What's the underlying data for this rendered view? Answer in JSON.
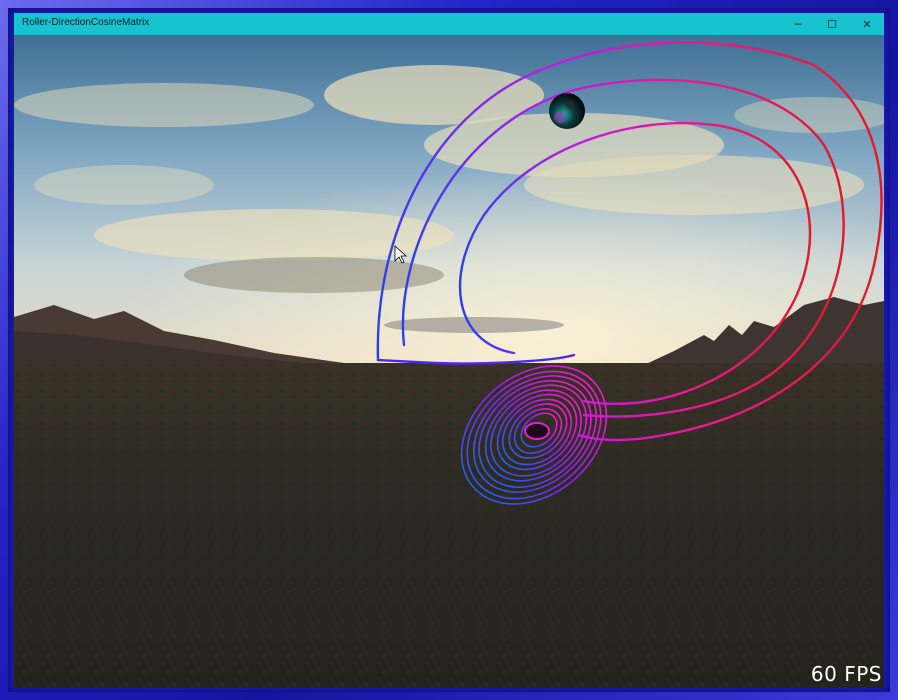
{
  "window": {
    "title": "Roller-DirectionCosineMatrix",
    "minimize_glyph": "─",
    "maximize_glyph": "☐",
    "close_glyph": "✕"
  },
  "scene": {
    "fps_label": "60 FPS",
    "objects": [
      "sky",
      "clouds",
      "mountains",
      "desert-ground",
      "attractor-curve",
      "sphere"
    ]
  },
  "colors": {
    "titlebar": "#17c3cf",
    "curve_red": "#e01a24",
    "curve_magenta": "#e21ad6",
    "curve_purple": "#9020f0",
    "curve_blue": "#2a40f0"
  },
  "icons": [
    "minimize-icon",
    "maximize-icon",
    "close-icon",
    "mouse-cursor-icon"
  ]
}
